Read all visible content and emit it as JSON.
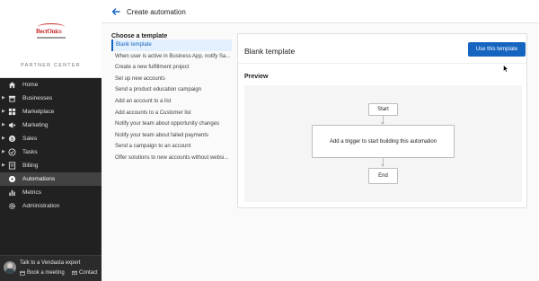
{
  "sidebar": {
    "logo_text": "BectOnics",
    "partner_center": "PARTNER CENTER",
    "items": [
      {
        "label": "Home",
        "icon": "home-icon",
        "expandable": false,
        "active": false
      },
      {
        "label": "Businesses",
        "icon": "store-icon",
        "expandable": true,
        "active": false
      },
      {
        "label": "Marketplace",
        "icon": "grid-icon",
        "expandable": true,
        "active": false
      },
      {
        "label": "Marketing",
        "icon": "megaphone-icon",
        "expandable": true,
        "active": false
      },
      {
        "label": "Sales",
        "icon": "dollar-icon",
        "expandable": true,
        "active": false
      },
      {
        "label": "Tasks",
        "icon": "check-circle-icon",
        "expandable": true,
        "active": false
      },
      {
        "label": "Billing",
        "icon": "billing-icon",
        "expandable": true,
        "active": false
      },
      {
        "label": "Automations",
        "icon": "automation-icon",
        "expandable": false,
        "active": true
      },
      {
        "label": "Metrics",
        "icon": "bar-chart-icon",
        "expandable": false,
        "active": false
      },
      {
        "label": "Administration",
        "icon": "gear-icon",
        "expandable": false,
        "active": false
      }
    ],
    "footer": {
      "talk_label": "Talk to a Vendasta expert",
      "book_label": "Book a meeting",
      "contact_label": "Contact"
    }
  },
  "header": {
    "title": "Create automation"
  },
  "templates": {
    "heading": "Choose a template",
    "items": [
      "Blank template",
      "When user is active in Business App, notify Sa...",
      "Create a new fulfillment project",
      "Set up new accounts",
      "Send a product education campaign",
      "Add an account to a list",
      "Add accounts to a Customer list",
      "Notify your team about opportunity changes",
      "Notify your team about failed payments",
      "Send a campaign to an account",
      "Offer solutions to new accounts without websi..."
    ],
    "selected_index": 0
  },
  "detail": {
    "title": "Blank template",
    "use_button": "Use this template",
    "preview_label": "Preview",
    "start_node": "Start",
    "trigger_node": "Add a trigger to start building this automation",
    "end_node": "End"
  },
  "colors": {
    "accent": "#1565c0",
    "sidebar_bg": "#212121",
    "selected_bg": "#e3f0fd"
  }
}
